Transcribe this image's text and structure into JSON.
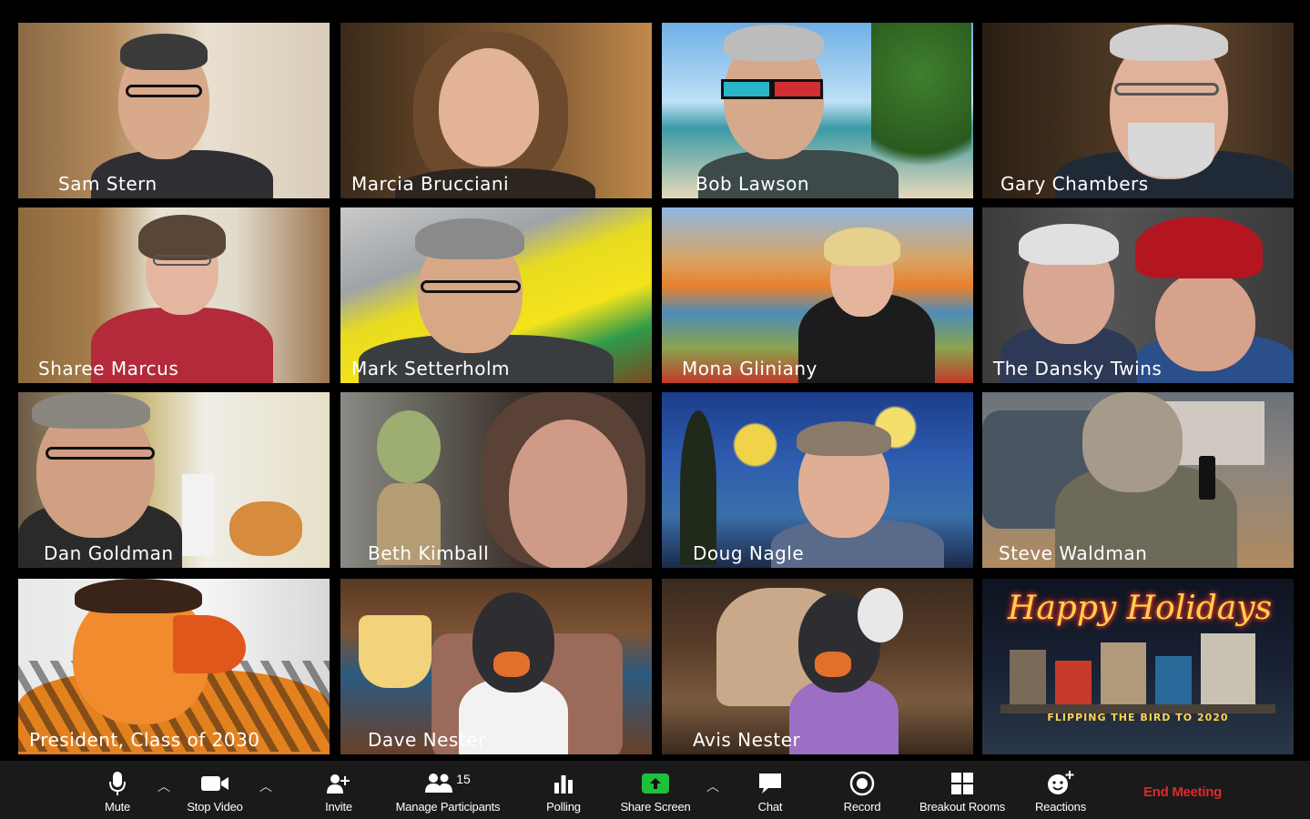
{
  "participants": [
    {
      "name": "Sam Stern"
    },
    {
      "name": "Marcia Brucciani"
    },
    {
      "name": "Bob Lawson"
    },
    {
      "name": "Gary Chambers"
    },
    {
      "name": "Sharee Marcus"
    },
    {
      "name": "Mark Setterholm"
    },
    {
      "name": "Mona Gliniany"
    },
    {
      "name": "The Dansky Twins"
    },
    {
      "name": "Dan Goldman"
    },
    {
      "name": "Beth Kimball"
    },
    {
      "name": "Doug Nagle"
    },
    {
      "name": "Steve Waldman"
    },
    {
      "name": "President, Class of 2030"
    },
    {
      "name": "Dave Nester"
    },
    {
      "name": "Avis Nester"
    },
    {
      "name": ""
    }
  ],
  "holiday_card": {
    "headline": "Happy Holidays",
    "tagline": "FLIPPING THE BIRD TO 2020"
  },
  "toolbar": {
    "mute": "Mute",
    "stop_video": "Stop Video",
    "invite": "Invite",
    "manage_participants": "Manage Participants",
    "participant_count": "15",
    "polling": "Polling",
    "share_screen": "Share Screen",
    "chat": "Chat",
    "record": "Record",
    "breakout_rooms": "Breakout Rooms",
    "reactions": "Reactions",
    "end_meeting": "End Meeting"
  },
  "colors": {
    "toolbar_bg": "#1a1a1a",
    "end_meeting": "#e02828",
    "share_green": "#1fbf3a"
  }
}
